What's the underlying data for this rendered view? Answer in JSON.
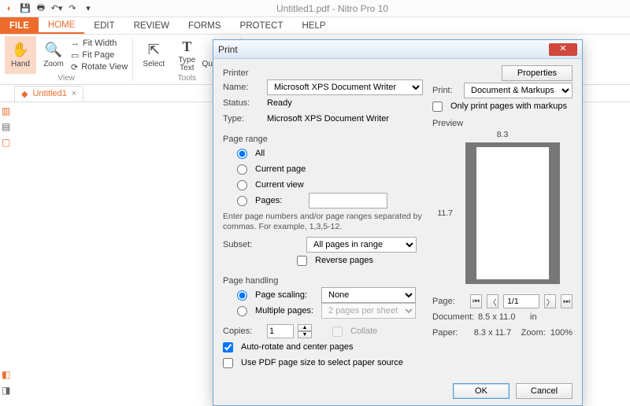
{
  "app": {
    "title": "Untitled1.pdf - Nitro Pro 10"
  },
  "tabs": {
    "file": "FILE",
    "home": "HOME",
    "edit": "EDIT",
    "review": "REVIEW",
    "forms": "FORMS",
    "protect": "PROTECT",
    "help": "HELP"
  },
  "ribbon": {
    "hand": "Hand",
    "zoom": "Zoom",
    "fitwidth": "Fit Width",
    "fitpage": "Fit Page",
    "rotate": "Rotate View",
    "view_group": "View",
    "select": "Select",
    "typetext": "Type\nText",
    "quicksign": "QuickSign",
    "tools_group": "Tools"
  },
  "doc": {
    "tab": "Untitled1",
    "close": "×"
  },
  "dialog": {
    "title": "Print",
    "printer_section": "Printer",
    "name": "Name:",
    "name_value": "Microsoft XPS Document Writer",
    "properties": "Properties",
    "status": "Status:",
    "status_value": "Ready",
    "type": "Type:",
    "type_value": "Microsoft XPS Document Writer",
    "print": "Print:",
    "print_value": "Document & Markups",
    "only_markups": "Only print pages with markups",
    "range_section": "Page range",
    "all": "All",
    "current_page": "Current page",
    "current_view": "Current view",
    "pages": "Pages:",
    "range_note": "Enter page numbers and/or page ranges separated by commas. For example, 1,3,5-12.",
    "subset": "Subset:",
    "subset_value": "All pages in range",
    "reverse": "Reverse pages",
    "handling_section": "Page handling",
    "scaling": "Page scaling:",
    "scaling_value": "None",
    "multiple": "Multiple pages:",
    "multiple_value": "2 pages per sheet",
    "copies": "Copies:",
    "copies_value": "1",
    "collate": "Collate",
    "autorotate": "Auto-rotate and center pages",
    "usepdf": "Use PDF page size to select paper source",
    "preview_section": "Preview",
    "paper_w": "8.3",
    "paper_h": "11.7",
    "nav": {
      "page": "Page:",
      "page_value": "1/1",
      "doc": "Document:",
      "doc_value": "8.5 x 11.0",
      "unit": "in",
      "paper": "Paper:",
      "paper_value": "8.3 x 11.7",
      "zoom": "Zoom:",
      "zoom_value": "100%"
    },
    "ok": "OK",
    "cancel": "Cancel"
  }
}
